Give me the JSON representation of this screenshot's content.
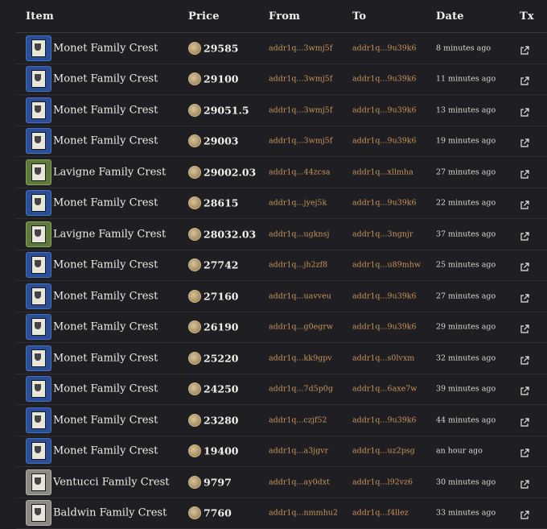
{
  "headers": {
    "item": "Item",
    "price": "Price",
    "from": "From",
    "to": "To",
    "date": "Date",
    "tx": "Tx"
  },
  "rows": [
    {
      "name": "Monet Family Crest",
      "price": "29585",
      "from": "addr1q...3wmj5f",
      "to": "addr1q...9u39k6",
      "date": "8 minutes ago",
      "thumb": "blue"
    },
    {
      "name": "Monet Family Crest",
      "price": "29100",
      "from": "addr1q...3wmj5f",
      "to": "addr1q...9u39k6",
      "date": "11 minutes ago",
      "thumb": "blue"
    },
    {
      "name": "Monet Family Crest",
      "price": "29051.5",
      "from": "addr1q...3wmj5f",
      "to": "addr1q...9u39k6",
      "date": "13 minutes ago",
      "thumb": "blue"
    },
    {
      "name": "Monet Family Crest",
      "price": "29003",
      "from": "addr1q...3wmj5f",
      "to": "addr1q...9u39k6",
      "date": "19 minutes ago",
      "thumb": "blue"
    },
    {
      "name": "Lavigne Family Crest",
      "price": "29002.03",
      "from": "addr1q...44zcsa",
      "to": "addr1q...xllmha",
      "date": "27 minutes ago",
      "thumb": "green"
    },
    {
      "name": "Monet Family Crest",
      "price": "28615",
      "from": "addr1q...jyej5k",
      "to": "addr1q...9u39k6",
      "date": "22 minutes ago",
      "thumb": "blue"
    },
    {
      "name": "Lavigne Family Crest",
      "price": "28032.03",
      "from": "addr1q...ugknsj",
      "to": "addr1q...3ngnjr",
      "date": "37 minutes ago",
      "thumb": "green"
    },
    {
      "name": "Monet Family Crest",
      "price": "27742",
      "from": "addr1q...jh2zf8",
      "to": "addr1q...u89mhw",
      "date": "25 minutes ago",
      "thumb": "blue"
    },
    {
      "name": "Monet Family Crest",
      "price": "27160",
      "from": "addr1q...uavveu",
      "to": "addr1q...9u39k6",
      "date": "27 minutes ago",
      "thumb": "blue"
    },
    {
      "name": "Monet Family Crest",
      "price": "26190",
      "from": "addr1q...g0egrw",
      "to": "addr1q...9u39k6",
      "date": "29 minutes ago",
      "thumb": "blue"
    },
    {
      "name": "Monet Family Crest",
      "price": "25220",
      "from": "addr1q...kk9gpv",
      "to": "addr1q...s0lvxm",
      "date": "32 minutes ago",
      "thumb": "blue"
    },
    {
      "name": "Monet Family Crest",
      "price": "24250",
      "from": "addr1q...7d5p0g",
      "to": "addr1q...6axe7w",
      "date": "39 minutes ago",
      "thumb": "blue"
    },
    {
      "name": "Monet Family Crest",
      "price": "23280",
      "from": "addr1q...czjf52",
      "to": "addr1q...9u39k6",
      "date": "44 minutes ago",
      "thumb": "blue"
    },
    {
      "name": "Monet Family Crest",
      "price": "19400",
      "from": "addr1q...a3jgvr",
      "to": "addr1q...uz2psg",
      "date": "an hour ago",
      "thumb": "blue"
    },
    {
      "name": "Ventucci Family Crest",
      "price": "9797",
      "from": "addr1q...ay0dxt",
      "to": "addr1q...l92vz6",
      "date": "30 minutes ago",
      "thumb": "gray"
    },
    {
      "name": "Baldwin Family Crest",
      "price": "7760",
      "from": "addr1q...nmmhu2",
      "to": "addr1q...f4llez",
      "date": "33 minutes ago",
      "thumb": "gray"
    }
  ],
  "colors": {
    "background": "#1f1f23",
    "address": "#c9965a",
    "divider": "#2e2e33"
  },
  "icons": {
    "coin": "coin-icon",
    "tx": "external-link-icon"
  }
}
